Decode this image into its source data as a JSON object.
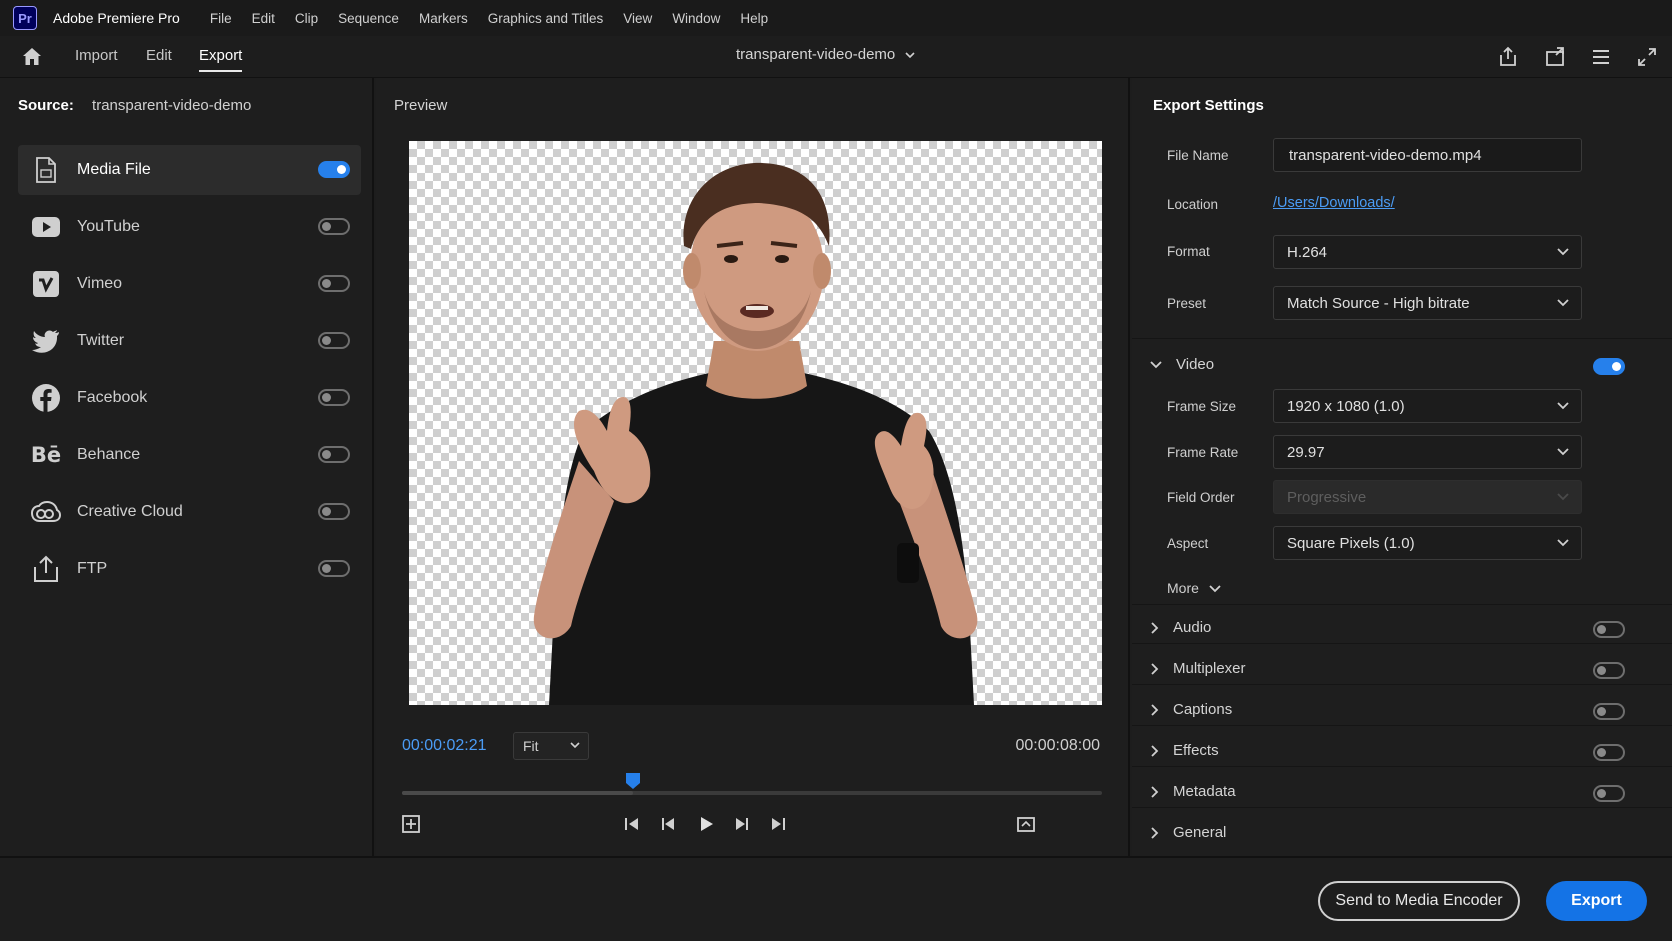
{
  "app": {
    "logo": "Pr",
    "title": "Adobe Premiere Pro"
  },
  "menu": [
    "File",
    "Edit",
    "Clip",
    "Sequence",
    "Markers",
    "Graphics and Titles",
    "View",
    "Window",
    "Help"
  ],
  "nav": {
    "tabs": [
      "Import",
      "Edit",
      "Export"
    ],
    "active_tab": "Export",
    "sequence_title": "transparent-video-demo",
    "right_icons": [
      "share-icon",
      "quick-export-icon",
      "menu-icon",
      "fullscreen-icon"
    ]
  },
  "source": {
    "label": "Source:",
    "name": "transparent-video-demo"
  },
  "destinations": [
    {
      "label": "Media File",
      "icon": "media-file-icon",
      "enabled": true,
      "selected": true
    },
    {
      "label": "YouTube",
      "icon": "youtube-icon",
      "enabled": false
    },
    {
      "label": "Vimeo",
      "icon": "vimeo-icon",
      "enabled": false
    },
    {
      "label": "Twitter",
      "icon": "twitter-icon",
      "enabled": false
    },
    {
      "label": "Facebook",
      "icon": "facebook-icon",
      "enabled": false
    },
    {
      "label": "Behance",
      "icon": "behance-icon",
      "enabled": false
    },
    {
      "label": "Creative Cloud",
      "icon": "creative-cloud-icon",
      "enabled": false
    },
    {
      "label": "FTP",
      "icon": "ftp-icon",
      "enabled": false
    }
  ],
  "preview": {
    "title": "Preview",
    "current_time": "00:00:02:21",
    "zoom": "Fit",
    "total_time": "00:00:08:00",
    "playhead_fraction": 0.33
  },
  "export_settings": {
    "title": "Export Settings",
    "file_name_label": "File Name",
    "file_name": "transparent-video-demo.mp4",
    "location_label": "Location",
    "location": "/Users/Downloads/",
    "format_label": "Format",
    "format": "H.264",
    "preset_label": "Preset",
    "preset": "Match Source - High bitrate",
    "video": {
      "label": "Video",
      "enabled": true,
      "frame_size_label": "Frame Size",
      "frame_size": "1920 x 1080 (1.0)",
      "frame_rate_label": "Frame Rate",
      "frame_rate": "29.97",
      "field_order_label": "Field Order",
      "field_order": "Progressive",
      "aspect_label": "Aspect",
      "aspect": "Square Pixels (1.0)",
      "more_label": "More"
    },
    "sections": [
      {
        "label": "Audio",
        "has_toggle": true,
        "enabled": false
      },
      {
        "label": "Multiplexer",
        "has_toggle": true,
        "enabled": false
      },
      {
        "label": "Captions",
        "has_toggle": true,
        "enabled": false
      },
      {
        "label": "Effects",
        "has_toggle": true,
        "enabled": false
      },
      {
        "label": "Metadata",
        "has_toggle": true,
        "enabled": false
      },
      {
        "label": "General",
        "has_toggle": false
      }
    ]
  },
  "footer": {
    "send_to_encoder": "Send to Media Encoder",
    "export": "Export"
  },
  "colors": {
    "accent": "#1473e6",
    "link": "#4b9cf5",
    "toggle_on": "#2680eb"
  }
}
